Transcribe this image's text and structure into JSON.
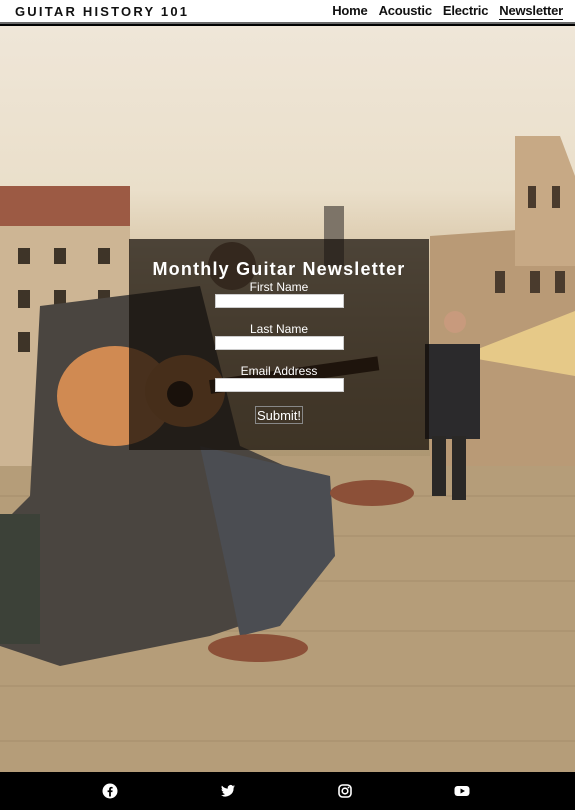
{
  "header": {
    "brand": "GUITAR HISTORY 101",
    "nav": [
      {
        "label": "Home"
      },
      {
        "label": "Acoustic"
      },
      {
        "label": "Electric"
      },
      {
        "label": "Newsletter",
        "active": true
      }
    ]
  },
  "newsletter": {
    "title": "Monthly Guitar Newsletter",
    "fields": [
      {
        "label": "First Name",
        "value": ""
      },
      {
        "label": "Last Name",
        "value": ""
      },
      {
        "label": "Email Address",
        "value": ""
      }
    ],
    "submit_label": "Submit!"
  },
  "footer": {
    "social": [
      "facebook-icon",
      "twitter-icon",
      "instagram-icon",
      "youtube-icon"
    ]
  }
}
